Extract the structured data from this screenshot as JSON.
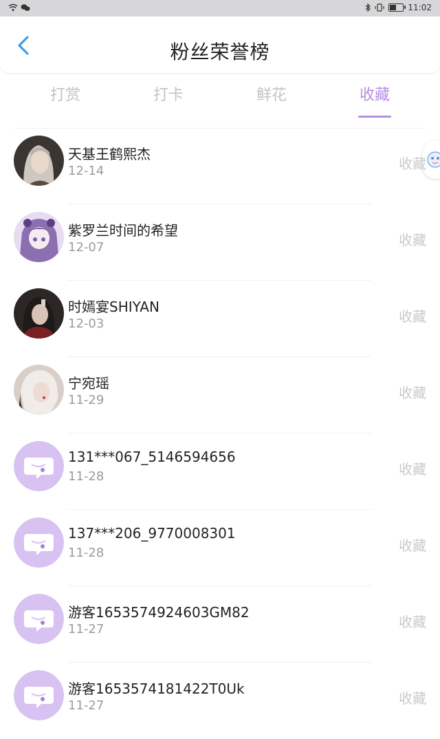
{
  "status_bar": {
    "time": "11:02"
  },
  "header": {
    "title": "粉丝荣誉榜"
  },
  "tabs": [
    {
      "label": "打赏"
    },
    {
      "label": "打卡"
    },
    {
      "label": "鲜花"
    },
    {
      "label": "收藏"
    }
  ],
  "active_tab": "收藏",
  "colors": {
    "accent": "#b48ee2",
    "back": "#3a9ee8",
    "default_avatar": "#d7c2f1"
  },
  "list": [
    {
      "name": "天基王鹤熙杰",
      "date": "12-14",
      "type": "收藏",
      "avatar": "photo-avatar"
    },
    {
      "name": "紫罗兰时间的希望",
      "date": "12-07",
      "type": "收藏",
      "avatar": "anime-avatar"
    },
    {
      "name": "时嫣宴SHIYAN",
      "date": "12-03",
      "type": "收藏",
      "avatar": "photo-avatar"
    },
    {
      "name": "宁宛瑶",
      "date": "11-29",
      "type": "收藏",
      "avatar": "photo-avatar"
    },
    {
      "name": "131***067_5146594656",
      "date": "11-28",
      "type": "收藏",
      "avatar": "default-avatar"
    },
    {
      "name": "137***206_9770008301",
      "date": "11-28",
      "type": "收藏",
      "avatar": "default-avatar"
    },
    {
      "name": "游客1653574924603GM82",
      "date": "11-27",
      "type": "收藏",
      "avatar": "default-avatar"
    },
    {
      "name": "游客1653574181422T0Uk",
      "date": "11-27",
      "type": "收藏",
      "avatar": "default-avatar"
    }
  ]
}
